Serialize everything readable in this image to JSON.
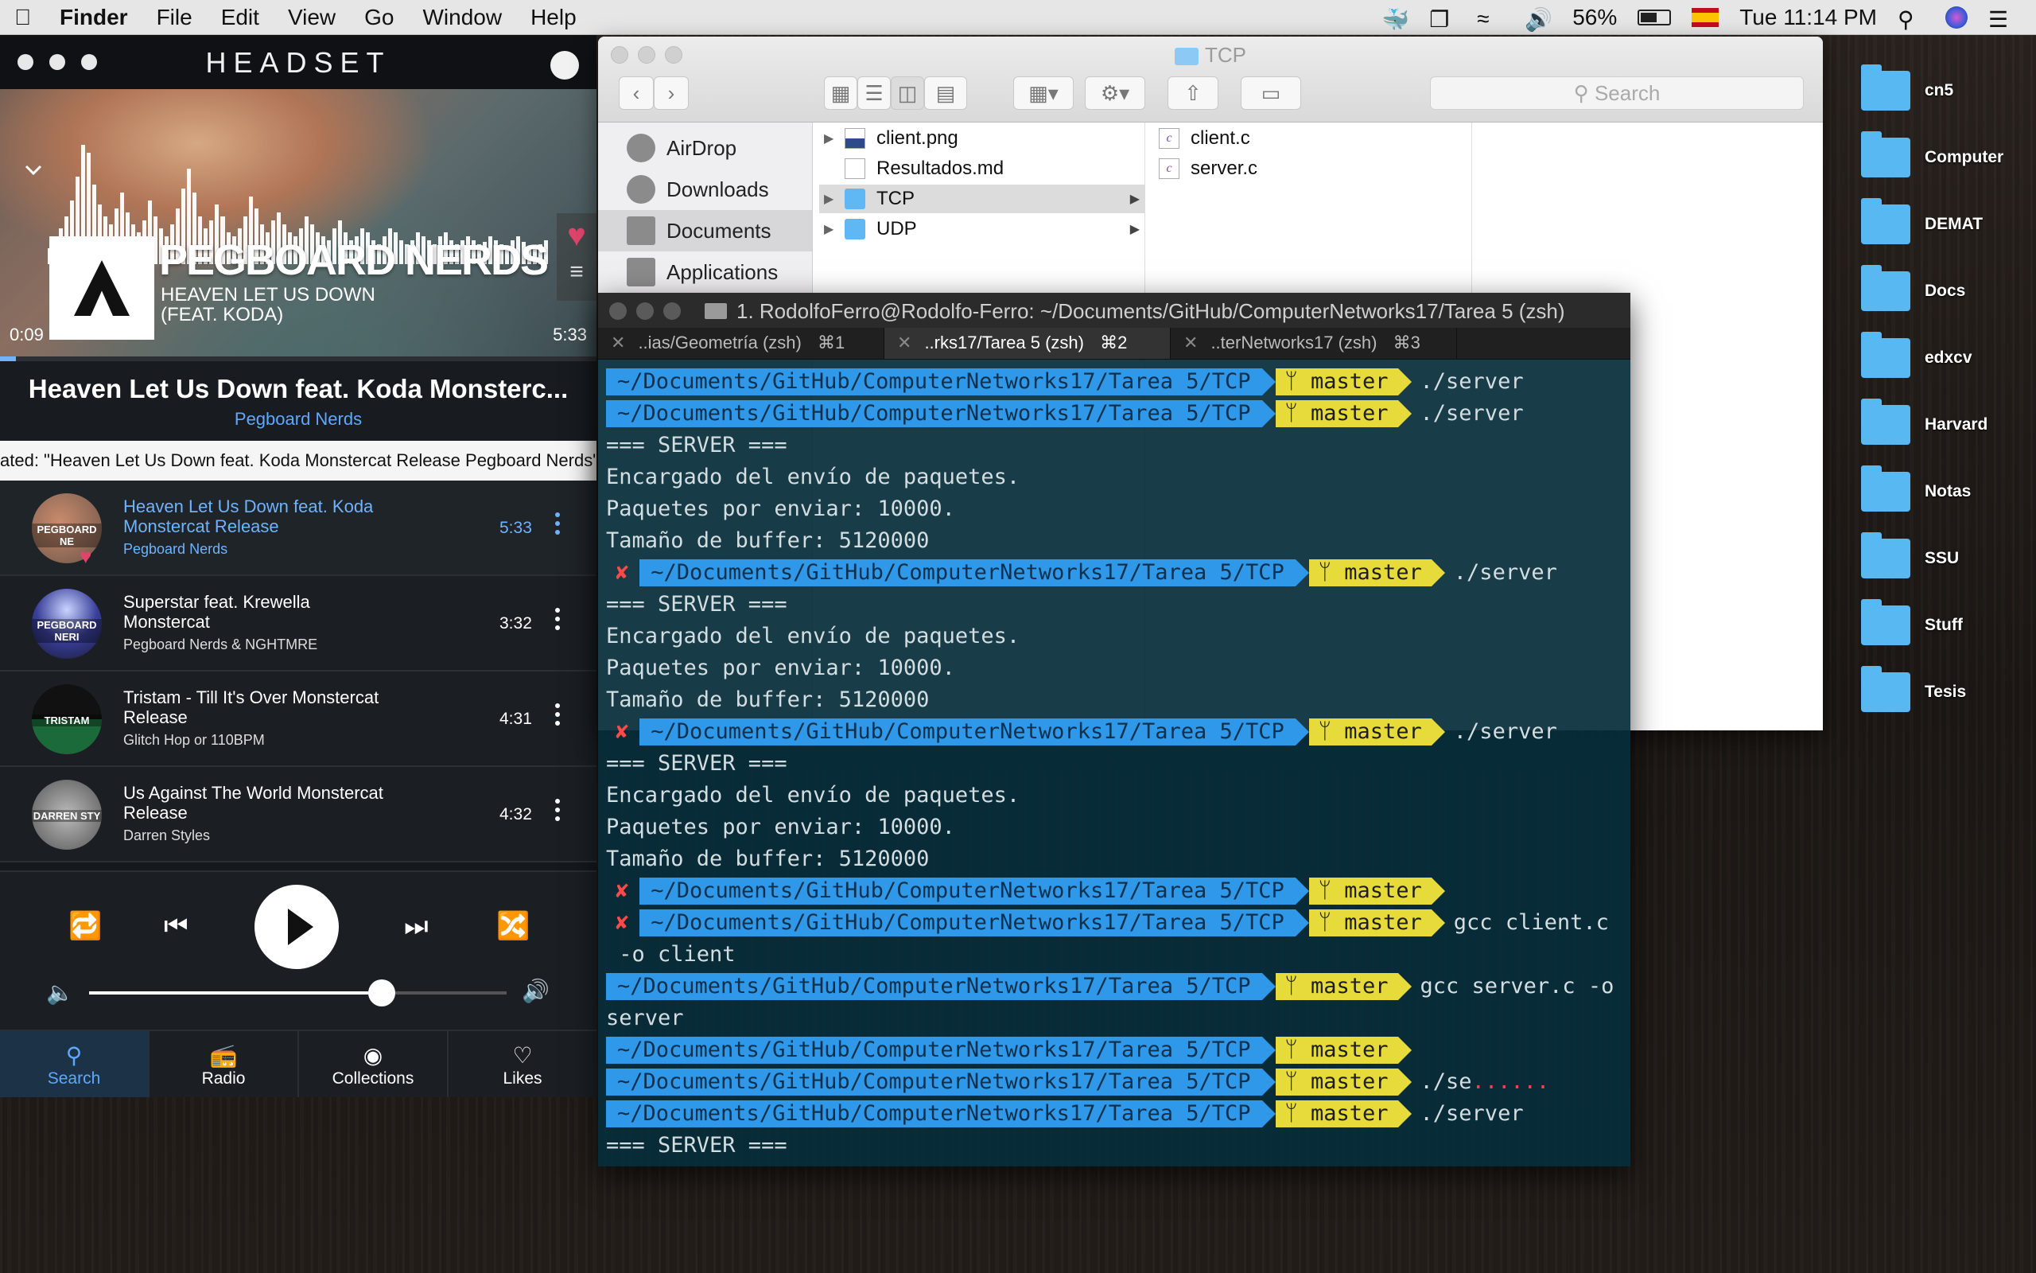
{
  "menubar": {
    "app": "Finder",
    "items": [
      "File",
      "Edit",
      "View",
      "Go",
      "Window",
      "Help"
    ],
    "battery": "56%",
    "clock": "Tue 11:14 PM"
  },
  "headset": {
    "logo": "HEADSET",
    "artist_big": "PEGBOARD NERDS",
    "song_big": "HEAVEN LET US DOWN (FEAT. KODA)",
    "time_elapsed": "0:09",
    "time_total": "5:33",
    "progress_fraction": 0.027,
    "now_title": "Heaven Let Us Down feat. Koda Monsterc...",
    "now_artist": "Pegboard Nerds",
    "marquee": "ated: \"Heaven Let Us Down feat. Koda Monstercat Release Pegboard Nerds\"",
    "queue": [
      {
        "title": "Heaven Let Us Down feat. Koda Monstercat Release",
        "artist": "Pegboard Nerds",
        "duration": "5:33",
        "thumb": "PEGBOARD NE",
        "active": true
      },
      {
        "title": "Superstar feat. Krewella Monstercat",
        "artist": "Pegboard Nerds & NGHTMRE",
        "duration": "3:32",
        "thumb": "PEGBOARD NERI",
        "active": false
      },
      {
        "title": "Tristam - Till It's Over Monstercat Release",
        "artist": "Glitch Hop or 110BPM",
        "duration": "4:31",
        "thumb": "TRISTAM",
        "active": false
      },
      {
        "title": "Us Against The World Monstercat Release",
        "artist": "Darren Styles",
        "duration": "4:32",
        "thumb": "DARREN STY",
        "active": false
      }
    ],
    "volume_fraction": 0.7,
    "nav": [
      {
        "label": "Search",
        "icon": "search-icon",
        "selected": true
      },
      {
        "label": "Radio",
        "icon": "radio-icon",
        "selected": false
      },
      {
        "label": "Collections",
        "icon": "disc-icon",
        "selected": false
      },
      {
        "label": "Likes",
        "icon": "heart-icon",
        "selected": false
      }
    ]
  },
  "finder": {
    "title": "TCP",
    "search_placeholder": "Search",
    "sidebar": [
      "AirDrop",
      "Downloads",
      "Documents",
      "Applications"
    ],
    "sidebar_selected": "Documents",
    "col1": [
      {
        "name": "client.png",
        "type": "img"
      },
      {
        "name": "Resultados.md",
        "type": "doc"
      },
      {
        "name": "TCP",
        "type": "folder",
        "selected": true
      },
      {
        "name": "UDP",
        "type": "folder"
      }
    ],
    "col2": [
      {
        "name": "client.c",
        "type": "c"
      },
      {
        "name": "server.c",
        "type": "c"
      }
    ]
  },
  "terminal": {
    "title": "1. RodolfoFerro@Rodolfo-Ferro: ~/Documents/GitHub/ComputerNetworks17/Tarea 5 (zsh)",
    "tabs": [
      {
        "label": "..ias/Geometría (zsh)",
        "shortcut": "⌘1"
      },
      {
        "label": "..rks17/Tarea 5 (zsh)",
        "shortcut": "⌘2",
        "selected": true
      },
      {
        "label": "..terNetworks17 (zsh)",
        "shortcut": "⌘3"
      }
    ],
    "path": "~/Documents/GitHub/ComputerNetworks17/Tarea 5/TCP",
    "branch": "master",
    "lines": [
      {
        "kind": "prompt",
        "fail": false,
        "cmd": "./server"
      },
      {
        "kind": "prompt",
        "fail": false,
        "cmd": "./server"
      },
      {
        "kind": "text",
        "text": "=== SERVER ==="
      },
      {
        "kind": "text",
        "text": "Encargado del envío de paquetes."
      },
      {
        "kind": "text",
        "text": "Paquetes por enviar: 10000."
      },
      {
        "kind": "text",
        "text": "Tamaño de buffer: 5120000"
      },
      {
        "kind": "prompt",
        "fail": true,
        "cmd": "./server"
      },
      {
        "kind": "text",
        "text": "=== SERVER ==="
      },
      {
        "kind": "text",
        "text": "Encargado del envío de paquetes."
      },
      {
        "kind": "text",
        "text": "Paquetes por enviar: 10000."
      },
      {
        "kind": "text",
        "text": "Tamaño de buffer: 5120000"
      },
      {
        "kind": "prompt",
        "fail": true,
        "cmd": "./server"
      },
      {
        "kind": "text",
        "text": "=== SERVER ==="
      },
      {
        "kind": "text",
        "text": "Encargado del envío de paquetes."
      },
      {
        "kind": "text",
        "text": "Paquetes por enviar: 10000."
      },
      {
        "kind": "text",
        "text": "Tamaño de buffer: 5120000"
      },
      {
        "kind": "prompt",
        "fail": true,
        "cmd": ""
      },
      {
        "kind": "prompt",
        "fail": true,
        "cmd": "gcc client.c"
      },
      {
        "kind": "text",
        "text": " -o client"
      },
      {
        "kind": "prompt",
        "fail": false,
        "cmd": "gcc server.c -o"
      },
      {
        "kind": "text",
        "text": "server"
      },
      {
        "kind": "prompt",
        "fail": false,
        "cmd": ""
      },
      {
        "kind": "prompt",
        "fail": false,
        "cmd": "./se",
        "dots": "......"
      },
      {
        "kind": "prompt",
        "fail": false,
        "cmd": "./server"
      },
      {
        "kind": "text",
        "text": "=== SERVER ==="
      }
    ]
  },
  "desktop": [
    "cn5",
    "Computer",
    "DEMAT",
    "Docs",
    "edxcv",
    "Harvard",
    "Notas",
    "SSU",
    "Stuff",
    "Tesis"
  ]
}
